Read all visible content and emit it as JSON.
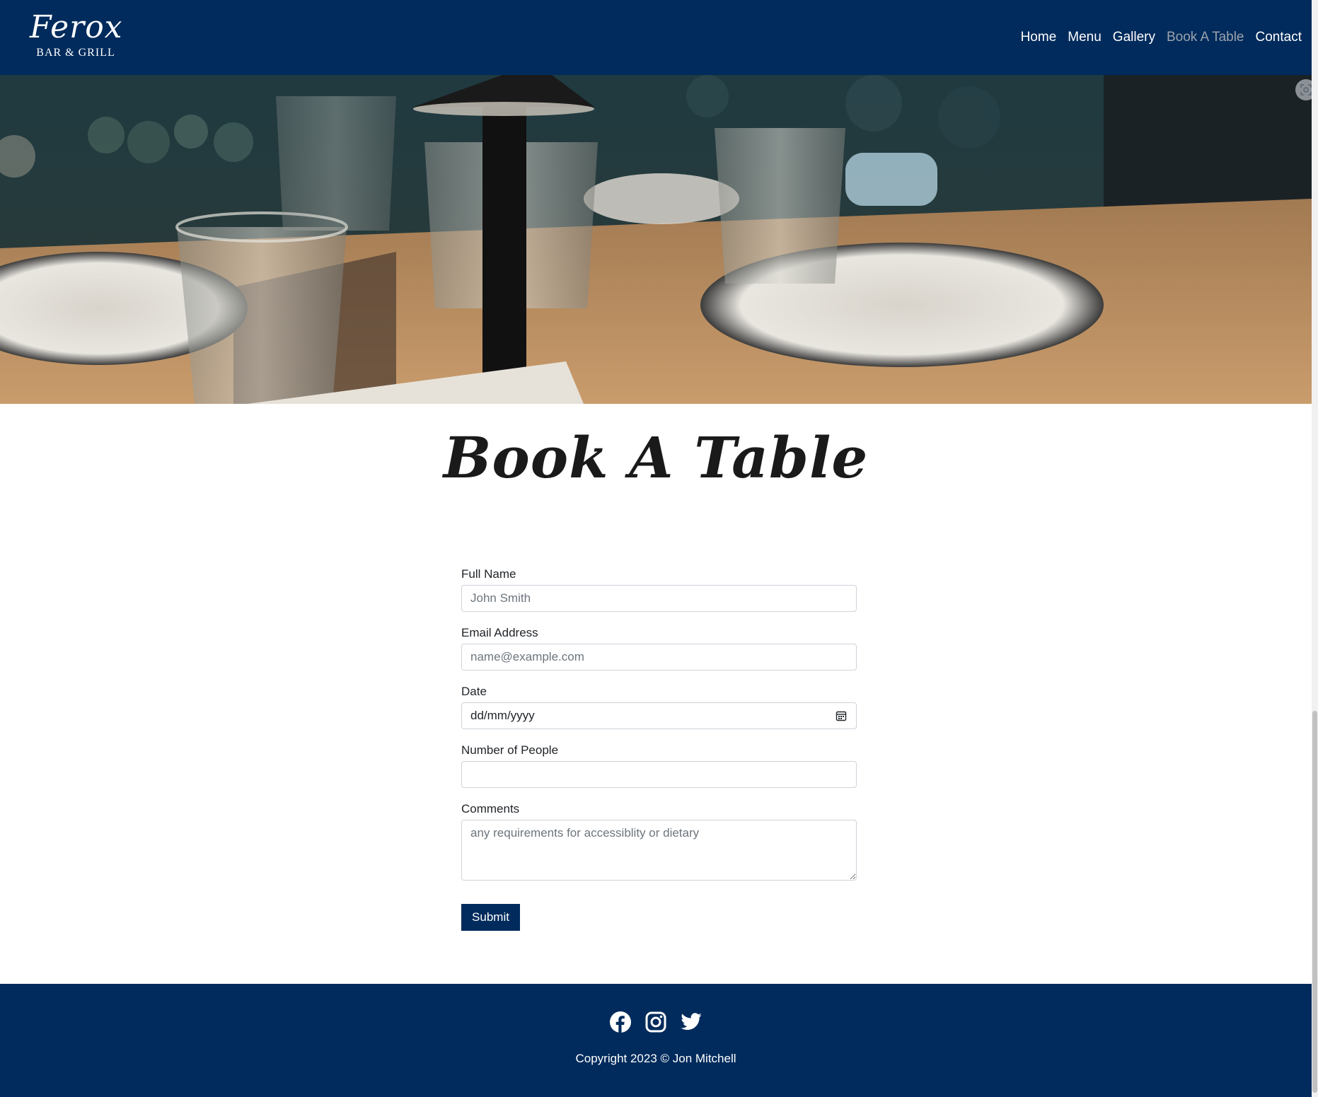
{
  "brand": {
    "name": "Ferox",
    "subtitle": "BAR & GRILL"
  },
  "nav": {
    "items": [
      {
        "label": "Home"
      },
      {
        "label": "Menu"
      },
      {
        "label": "Gallery"
      },
      {
        "label": "Book A Table",
        "active": true
      },
      {
        "label": "Contact"
      }
    ]
  },
  "page": {
    "title": "Book A Table"
  },
  "form": {
    "full_name": {
      "label": "Full Name",
      "placeholder": "John Smith"
    },
    "email": {
      "label": "Email Address",
      "placeholder": "name@example.com"
    },
    "date": {
      "label": "Date",
      "value": "dd/mm/yyyy"
    },
    "people": {
      "label": "Number of People",
      "placeholder": ""
    },
    "comments": {
      "label": "Comments",
      "placeholder": "any requirements for accessiblity or dietary"
    },
    "submit_label": "Submit"
  },
  "footer": {
    "social_icons": [
      "facebook-icon",
      "instagram-icon",
      "twitter-icon"
    ],
    "copyright": "Copyright 2023 © Jon Mitchell"
  },
  "colors": {
    "navy": "#002b5c",
    "active_nav": "#9aa3ad"
  }
}
